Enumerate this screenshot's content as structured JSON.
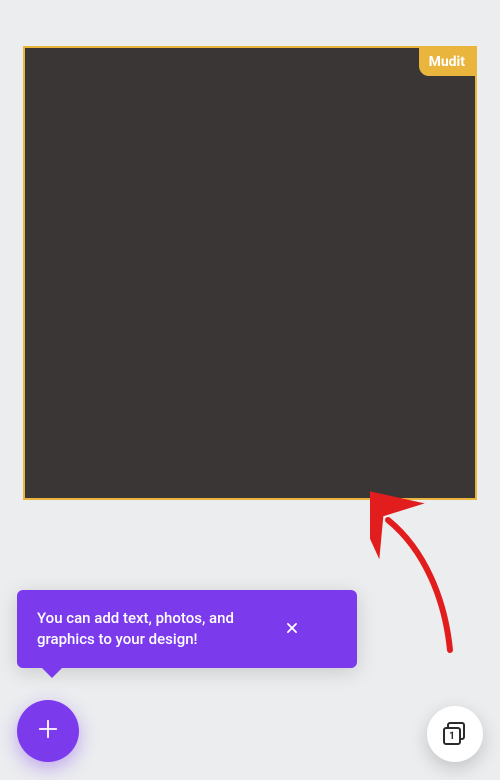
{
  "canvas": {
    "user_label": "Mudit",
    "selection_color": "#eab53d",
    "fill_color": "#3a3636"
  },
  "onboarding_tooltip": {
    "message": "You can add text, photos, and graphics to your design!",
    "background": "#7c3aed"
  },
  "fab": {
    "add_icon": "plus-icon",
    "pages_icon": "pages-icon",
    "page_count": "1"
  },
  "annotation": {
    "arrow_color": "#e11d1d"
  }
}
